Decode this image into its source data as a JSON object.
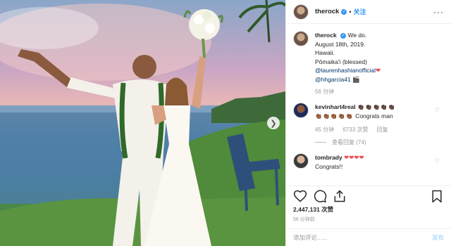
{
  "post": {
    "username": "therock",
    "follow_label": "关注",
    "separator": "•",
    "more_label": "···"
  },
  "caption": {
    "username": "therock",
    "lines": [
      "We do.",
      "August 18th, 2019.",
      "Hawaii.",
      "Pōmaika'i (blessed)"
    ],
    "mention_1": "@laurenhashianofficial",
    "mention_1_emoji": "❤",
    "mention_2": "@hhgarcia41",
    "mention_2_emoji": "🎬",
    "time": "56 分钟"
  },
  "comments": [
    {
      "username": "kevinhart4real",
      "emoji_line_1": "👏🏿👏🏿👏🏿👏🏿👏🏿",
      "emoji_line_2": "👏🏾👏🏾👏🏾👏🏾👏🏾",
      "text": "Congrats man",
      "time": "45 分钟",
      "likes": "6733 次赞",
      "reply_label": "回复",
      "view_replies": "查看回复 (74)"
    },
    {
      "username": "tombrady",
      "emoji_line_1": "❤❤❤❤",
      "text": "Congrats!!"
    }
  ],
  "likes": "2,447,131 次赞",
  "date": "56 分钟前",
  "add_comment": {
    "placeholder": "添加评论......",
    "post_label": "发布"
  },
  "icons": {
    "verified": "verified-badge",
    "heart": "heart-icon",
    "comment": "comment-icon",
    "share": "share-icon",
    "bookmark": "bookmark-icon",
    "next": "chevron-right-icon"
  },
  "colors": {
    "accent": "#3897f0",
    "like_red": "#ed4956",
    "muted": "#999999",
    "mention": "#003569"
  }
}
